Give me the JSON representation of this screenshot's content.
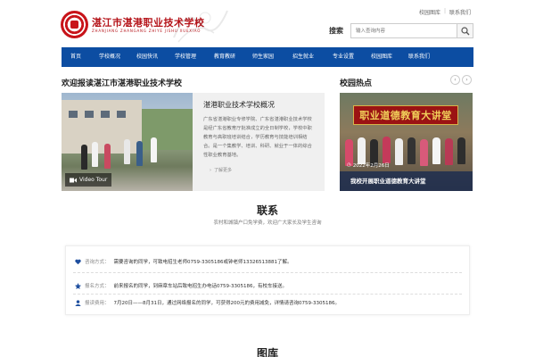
{
  "top_links": {
    "gallery": "校园图库",
    "contact": "联系我们"
  },
  "header": {
    "school_name": "湛江市湛港职业技术学校",
    "pinyin": "ZHANJIANG ZHANGANG ZHIYE JISHU XUEXIAO",
    "search_label": "搜索",
    "search_placeholder": "输入查询内容"
  },
  "nav": {
    "items": [
      "首页",
      "学校概况",
      "校园快讯",
      "学校管理",
      "教育教研",
      "师生家园",
      "招生就业",
      "专业设置",
      "校园图库",
      "联系我们"
    ]
  },
  "welcome": {
    "title": "欢迎报读湛江市湛港职业技术学校",
    "video_label": "Video Tour",
    "intro_heading": "湛港职业技术学校概况",
    "intro_text": "广东省湛港职业专修学院、广东省湛港职业技术学校是经广东省教育厅批准成立的全日制学校，学校中职教育与高职班培训结合，学历教育与技能培训相结合。是一个集教学、培训、科研、就业于一体的综合性职业教育基地。",
    "more": "了解更多"
  },
  "hot": {
    "title": "校园热点",
    "banner": "职业道德教育大讲堂",
    "date": "2022年2月26日",
    "caption": "我校开展职业道德教育大讲堂"
  },
  "contact": {
    "heading": "联系",
    "sub": "农村和城镇户口免学费，欢迎广大家长及学生咨询",
    "rows": [
      {
        "label": "咨询方式：",
        "text": "需要咨询的同学，可致电招生老师0759-3305186或钟老师13326513881了解。"
      },
      {
        "label": "报名方式：",
        "text": "前来报名的同学，到麻章车站后致电招生办电话0759-3305186，有校车接送。"
      },
      {
        "label": "报读费用：",
        "text": "7月20日——8月31日，通过网络报名的同学，可获得200元的费用减免，详情请咨询0759-3305186。"
      }
    ]
  },
  "gallery": {
    "heading": "图库"
  },
  "colors": {
    "nav": "#0c4da2",
    "brand_red": "#b51319",
    "icon_blue": "#1f4f9f"
  },
  "icons": {
    "search": "magnifier-icon",
    "video": "video-camera-icon",
    "more": "chevron-right-icon",
    "prev": "chevron-left-icon",
    "next": "chevron-right-icon",
    "date": "clock-icon",
    "consult": "heart-icon",
    "signup": "pin-icon",
    "fee": "user-icon"
  }
}
